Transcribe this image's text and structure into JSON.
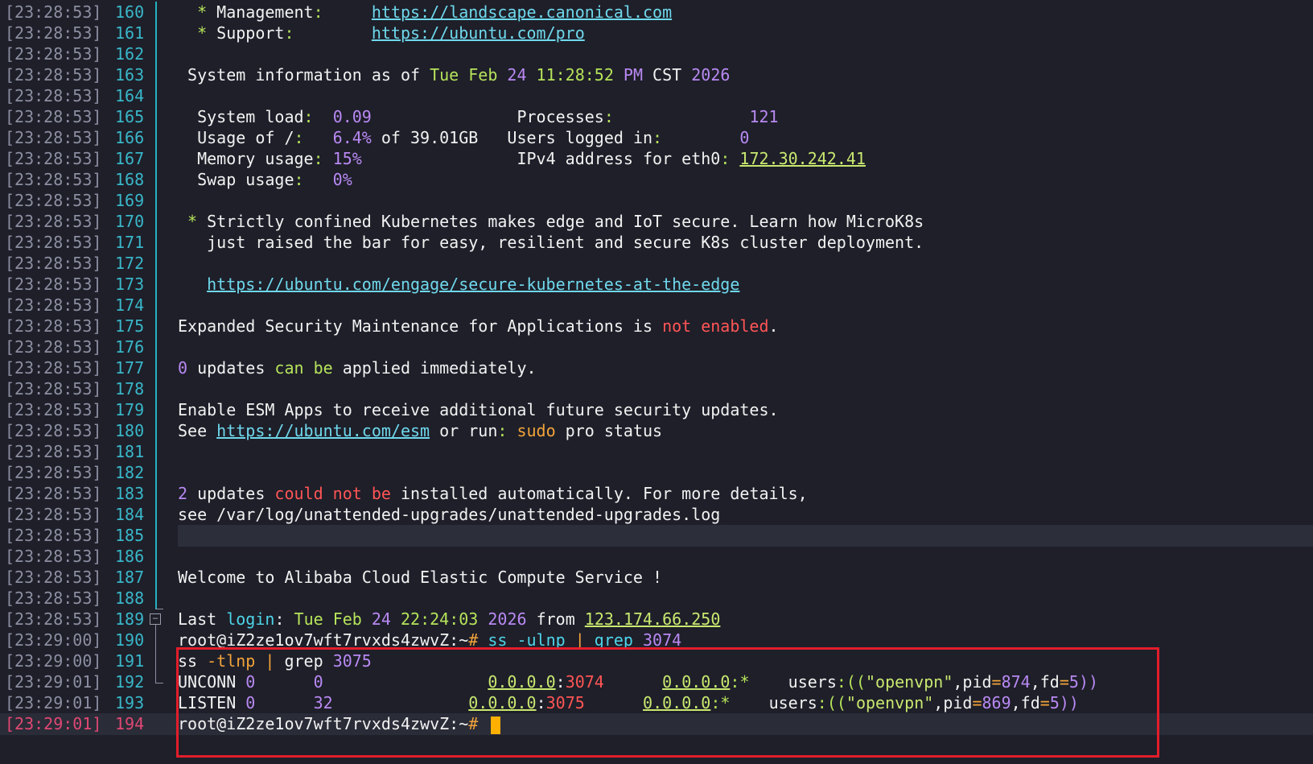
{
  "terminal": {
    "lines": [
      {
        "ts": "[23:28:53]",
        "ln": "160",
        "segs": [
          {
            "t": "  "
          },
          {
            "t": "*",
            "c": "c-green"
          },
          {
            "t": " Management"
          },
          {
            "t": ":",
            "c": "c-green"
          },
          {
            "t": "     "
          },
          {
            "t": "https://landscape.canonical.com",
            "c": "c-link"
          }
        ]
      },
      {
        "ts": "[23:28:53]",
        "ln": "161",
        "segs": [
          {
            "t": "  "
          },
          {
            "t": "*",
            "c": "c-green"
          },
          {
            "t": " Support"
          },
          {
            "t": ":",
            "c": "c-green"
          },
          {
            "t": "        "
          },
          {
            "t": "https://ubuntu.com/pro",
            "c": "c-link"
          }
        ]
      },
      {
        "ts": "[23:28:53]",
        "ln": "162",
        "segs": []
      },
      {
        "ts": "[23:28:53]",
        "ln": "163",
        "segs": [
          {
            "t": " System information as of "
          },
          {
            "t": "Tue Feb ",
            "c": "c-green"
          },
          {
            "t": "24",
            "c": "c-purple"
          },
          {
            "t": " "
          },
          {
            "t": "11:28:52",
            "c": "c-green"
          },
          {
            "t": " "
          },
          {
            "t": "PM",
            "c": "c-purple"
          },
          {
            "t": " CST "
          },
          {
            "t": "2026",
            "c": "c-purple"
          }
        ]
      },
      {
        "ts": "[23:28:53]",
        "ln": "164",
        "segs": []
      },
      {
        "ts": "[23:28:53]",
        "ln": "165",
        "segs": [
          {
            "t": "  System load"
          },
          {
            "t": ":",
            "c": "c-green"
          },
          {
            "t": "  "
          },
          {
            "t": "0.09",
            "c": "c-purple"
          },
          {
            "t": "               Processes"
          },
          {
            "t": ":",
            "c": "c-green"
          },
          {
            "t": "              "
          },
          {
            "t": "121",
            "c": "c-purple"
          }
        ]
      },
      {
        "ts": "[23:28:53]",
        "ln": "166",
        "segs": [
          {
            "t": "  Usage of /"
          },
          {
            "t": ":",
            "c": "c-green"
          },
          {
            "t": "   "
          },
          {
            "t": "6.4%",
            "c": "c-purple"
          },
          {
            "t": " of 39.01GB   Users logged in"
          },
          {
            "t": ":",
            "c": "c-green"
          },
          {
            "t": "        "
          },
          {
            "t": "0",
            "c": "c-purple"
          }
        ]
      },
      {
        "ts": "[23:28:53]",
        "ln": "167",
        "segs": [
          {
            "t": "  Memory usage"
          },
          {
            "t": ":",
            "c": "c-green"
          },
          {
            "t": " "
          },
          {
            "t": "15%",
            "c": "c-purple"
          },
          {
            "t": "                IPv4 address for eth0"
          },
          {
            "t": ":",
            "c": "c-green"
          },
          {
            "t": " "
          },
          {
            "t": "172.30.242.41",
            "c": "c-link-green"
          }
        ]
      },
      {
        "ts": "[23:28:53]",
        "ln": "168",
        "segs": [
          {
            "t": "  Swap usage"
          },
          {
            "t": ":",
            "c": "c-green"
          },
          {
            "t": "   "
          },
          {
            "t": "0%",
            "c": "c-purple"
          }
        ]
      },
      {
        "ts": "[23:28:53]",
        "ln": "169",
        "segs": []
      },
      {
        "ts": "[23:28:53]",
        "ln": "170",
        "segs": [
          {
            "t": " "
          },
          {
            "t": "*",
            "c": "c-green"
          },
          {
            "t": " Strictly confined Kubernetes makes edge and IoT secure. Learn how MicroK8s"
          }
        ]
      },
      {
        "ts": "[23:28:53]",
        "ln": "171",
        "segs": [
          {
            "t": "   just raised the bar for easy, resilient and secure K8s cluster deployment."
          }
        ]
      },
      {
        "ts": "[23:28:53]",
        "ln": "172",
        "segs": []
      },
      {
        "ts": "[23:28:53]",
        "ln": "173",
        "segs": [
          {
            "t": "   "
          },
          {
            "t": "https://ubuntu.com/engage/secure-kubernetes-at-the-edge",
            "c": "c-link"
          }
        ]
      },
      {
        "ts": "[23:28:53]",
        "ln": "174",
        "segs": []
      },
      {
        "ts": "[23:28:53]",
        "ln": "175",
        "segs": [
          {
            "t": "Expanded Security Maintenance for Applications is "
          },
          {
            "t": "not enabled",
            "c": "c-red"
          },
          {
            "t": "."
          }
        ]
      },
      {
        "ts": "[23:28:53]",
        "ln": "176",
        "segs": []
      },
      {
        "ts": "[23:28:53]",
        "ln": "177",
        "segs": [
          {
            "t": "0",
            "c": "c-purple"
          },
          {
            "t": " updates "
          },
          {
            "t": "can be",
            "c": "c-green"
          },
          {
            "t": " applied immediately."
          }
        ]
      },
      {
        "ts": "[23:28:53]",
        "ln": "178",
        "segs": []
      },
      {
        "ts": "[23:28:53]",
        "ln": "179",
        "segs": [
          {
            "t": "Enable ESM Apps to receive additional future security updates."
          }
        ]
      },
      {
        "ts": "[23:28:53]",
        "ln": "180",
        "segs": [
          {
            "t": "See "
          },
          {
            "t": "https://ubuntu.com/esm",
            "c": "c-link"
          },
          {
            "t": " or run"
          },
          {
            "t": ":",
            "c": "c-green"
          },
          {
            "t": " "
          },
          {
            "t": "sudo",
            "c": "c-orange"
          },
          {
            "t": " pro status"
          }
        ]
      },
      {
        "ts": "[23:28:53]",
        "ln": "181",
        "segs": []
      },
      {
        "ts": "[23:28:53]",
        "ln": "182",
        "segs": []
      },
      {
        "ts": "[23:28:53]",
        "ln": "183",
        "segs": [
          {
            "t": "2",
            "c": "c-purple"
          },
          {
            "t": " updates "
          },
          {
            "t": "could not be",
            "c": "c-red"
          },
          {
            "t": " installed automatically. For more details,"
          }
        ]
      },
      {
        "ts": "[23:28:53]",
        "ln": "184",
        "segs": [
          {
            "t": "see /var/log/unattended-upgrades/unattended-upgrades.log"
          }
        ]
      },
      {
        "ts": "[23:28:53]",
        "ln": "185",
        "segs": [],
        "hl": true
      },
      {
        "ts": "[23:28:53]",
        "ln": "186",
        "segs": []
      },
      {
        "ts": "[23:28:53]",
        "ln": "187",
        "segs": [
          {
            "t": "Welcome to Alibaba Cloud Elastic Compute Service !"
          }
        ]
      },
      {
        "ts": "[23:28:53]",
        "ln": "188",
        "segs": []
      },
      {
        "ts": "[23:28:53]",
        "ln": "189",
        "segs": [
          {
            "t": "Last "
          },
          {
            "t": "login",
            "c": "c-cyan"
          },
          {
            "t": ": "
          },
          {
            "t": "Tue Feb ",
            "c": "c-green"
          },
          {
            "t": "24",
            "c": "c-purple"
          },
          {
            "t": " "
          },
          {
            "t": "22:24:03",
            "c": "c-green"
          },
          {
            "t": " "
          },
          {
            "t": "2026",
            "c": "c-purple"
          },
          {
            "t": " from "
          },
          {
            "t": "123.174.66.250",
            "c": "c-link-green"
          }
        ]
      },
      {
        "ts": "[23:29:00]",
        "ln": "190",
        "segs": [
          {
            "t": "root@iZ2ze1ov7wft7rvxds4zwvZ:~"
          },
          {
            "t": "#",
            "c": "c-orange"
          },
          {
            "t": " "
          },
          {
            "t": "ss -ulnp",
            "c": "c-cyan"
          },
          {
            "t": " "
          },
          {
            "t": "|",
            "c": "c-orange"
          },
          {
            "t": " "
          },
          {
            "t": "grep",
            "c": "c-cyan"
          },
          {
            "t": " "
          },
          {
            "t": "3074",
            "c": "c-purple"
          }
        ]
      },
      {
        "ts": "[23:29:00]",
        "ln": "191",
        "segs": [
          {
            "t": "ss "
          },
          {
            "t": "-tlnp",
            "c": "c-orange"
          },
          {
            "t": " "
          },
          {
            "t": "|",
            "c": "c-orange"
          },
          {
            "t": " grep "
          },
          {
            "t": "3075",
            "c": "c-purple"
          }
        ]
      },
      {
        "ts": "[23:29:01]",
        "ln": "192",
        "segs": [
          {
            "t": "UNCONN "
          },
          {
            "t": "0",
            "c": "c-purple"
          },
          {
            "t": "      "
          },
          {
            "t": "0",
            "c": "c-purple"
          },
          {
            "t": "                 "
          },
          {
            "t": "0.0.0.0",
            "c": "c-link-green"
          },
          {
            "t": ":"
          },
          {
            "t": "3074",
            "c": "c-red"
          },
          {
            "t": "      "
          },
          {
            "t": "0.0.0.0",
            "c": "c-link-green"
          },
          {
            "t": ":*",
            "c": "c-green"
          },
          {
            "t": "    users"
          },
          {
            "t": ":((",
            "c": "c-green"
          },
          {
            "t": "\"openvpn\"",
            "c": "c-yellowgreen"
          },
          {
            "t": ",pid"
          },
          {
            "t": "=",
            "c": "c-orange"
          },
          {
            "t": "874",
            "c": "c-purple"
          },
          {
            "t": ",fd"
          },
          {
            "t": "=",
            "c": "c-orange"
          },
          {
            "t": "5",
            "c": "c-purple"
          },
          {
            "t": "))",
            "c": "c-purple"
          }
        ]
      },
      {
        "ts": "[23:29:01]",
        "ln": "193",
        "segs": [
          {
            "t": "LISTEN "
          },
          {
            "t": "0",
            "c": "c-purple"
          },
          {
            "t": "      "
          },
          {
            "t": "32",
            "c": "c-purple"
          },
          {
            "t": "              "
          },
          {
            "t": "0.0.0.0",
            "c": "c-link-green"
          },
          {
            "t": ":"
          },
          {
            "t": "3075",
            "c": "c-red"
          },
          {
            "t": "      "
          },
          {
            "t": "0.0.0.0",
            "c": "c-link-green"
          },
          {
            "t": ":*",
            "c": "c-green"
          },
          {
            "t": "    users"
          },
          {
            "t": ":((",
            "c": "c-green"
          },
          {
            "t": "\"openvpn\"",
            "c": "c-yellowgreen"
          },
          {
            "t": ",pid"
          },
          {
            "t": "=",
            "c": "c-orange"
          },
          {
            "t": "869",
            "c": "c-purple"
          },
          {
            "t": ",fd"
          },
          {
            "t": "=",
            "c": "c-orange"
          },
          {
            "t": "5",
            "c": "c-purple"
          },
          {
            "t": "))",
            "c": "c-purple"
          }
        ]
      },
      {
        "ts": "[23:29:01]",
        "ln": "194",
        "segs": [
          {
            "t": "root@iZ2ze1ov7wft7rvxds4zwvZ:~"
          },
          {
            "t": "#",
            "c": "c-orange"
          },
          {
            "t": " "
          }
        ],
        "active": true,
        "cursor": true
      }
    ]
  },
  "colors": {
    "background": "#1e1f29",
    "highlight_box": "#e31d2b",
    "gutter": "#23b2c2",
    "cursor": "#ffb000"
  },
  "icons": {
    "fold_toggle": "minus-square-icon"
  }
}
